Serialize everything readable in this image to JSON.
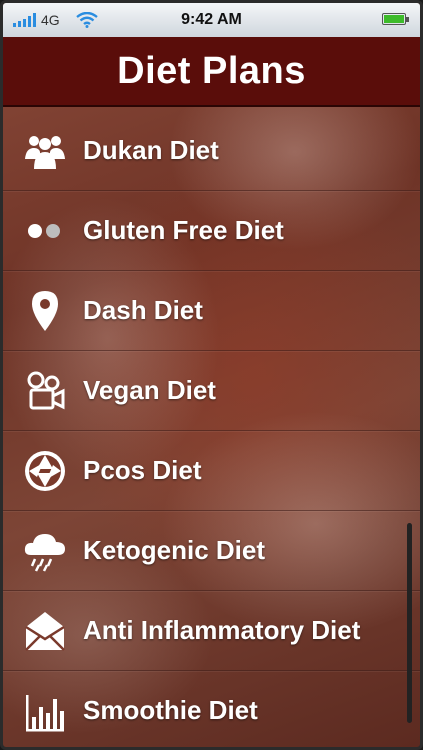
{
  "status_bar": {
    "network": "4G",
    "time": "9:42 AM"
  },
  "nav": {
    "title": "Diet Plans",
    "bar_color": "#5a0d0a"
  },
  "menu": {
    "items": [
      {
        "label": "Dukan Diet",
        "icon": "users-icon"
      },
      {
        "label": "Gluten Free Diet",
        "icon": "two-dots-icon"
      },
      {
        "label": "Dash Diet",
        "icon": "map-pin-icon"
      },
      {
        "label": "Vegan Diet",
        "icon": "video-camera-icon"
      },
      {
        "label": "Pcos Diet",
        "icon": "camera-aperture-icon"
      },
      {
        "label": "Ketogenic Diet",
        "icon": "rain-cloud-icon"
      },
      {
        "label": "Anti Inflammatory Diet",
        "icon": "envelope-icon"
      },
      {
        "label": "Smoothie Diet",
        "icon": "bar-chart-icon"
      }
    ]
  }
}
